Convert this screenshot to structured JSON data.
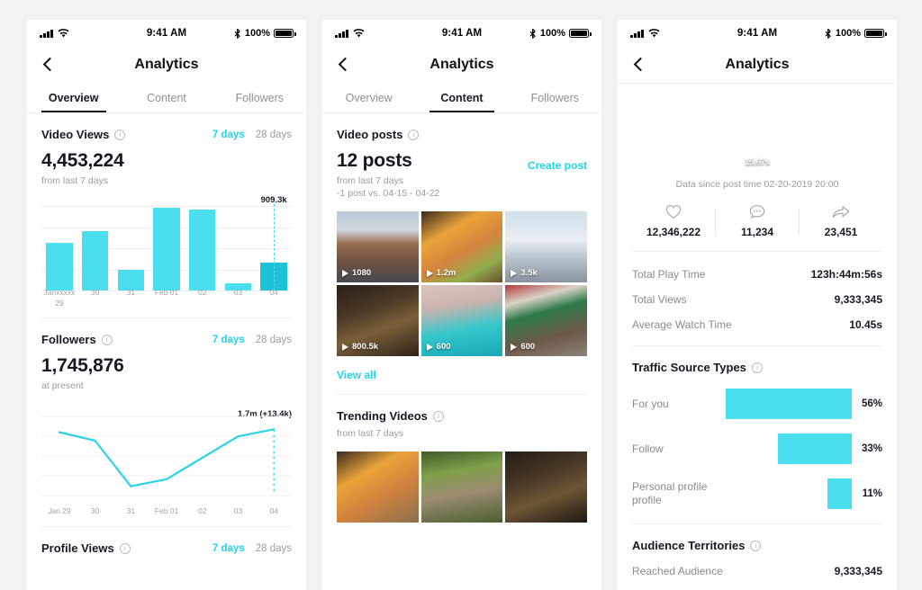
{
  "statusbar": {
    "time": "9:41 AM",
    "battery_pct": "100%",
    "signal_icon": "signal-bars-icon",
    "wifi_icon": "wifi-icon",
    "bluetooth_icon": "bluetooth-icon",
    "battery_icon": "battery-icon"
  },
  "nav": {
    "title": "Analytics",
    "back_icon": "back-chevron-icon"
  },
  "tabs": {
    "overview": "Overview",
    "content": "Content",
    "followers": "Followers"
  },
  "range": {
    "seven": "7 days",
    "twentyeight": "28 days"
  },
  "colors": {
    "accent": "#20d5ec",
    "bar": "#4adeee",
    "bar_highlight": "#1cc3d7",
    "text": "#161823",
    "muted": "#9b9b9b"
  },
  "panel1": {
    "video_views": {
      "title": "Video Views",
      "value": "4,453,224",
      "subnote": "from last 7 days"
    },
    "followers": {
      "title": "Followers",
      "value": "1,745,876",
      "subnote": "at present"
    },
    "profile_views": {
      "title": "Profile Views"
    }
  },
  "panel2": {
    "video_posts": {
      "title": "Video posts",
      "count": "12 posts",
      "create_post": "Create post",
      "subnote1": "from last 7 days",
      "subnote2": "-1 post vs. 04-15 - 04-22",
      "view_all": "View all",
      "posts": [
        {
          "views": "1080",
          "name": "city-street-thumbnail"
        },
        {
          "views": "1.2m",
          "name": "burger-thumbnail"
        },
        {
          "views": "3.5k",
          "name": "snow-picnic-thumbnail"
        },
        {
          "views": "800.5k",
          "name": "dark-corridor-thumbnail"
        },
        {
          "views": "600",
          "name": "venice-gondola-thumbnail"
        },
        {
          "views": "600",
          "name": "cafe-terrace-thumbnail"
        }
      ]
    },
    "trending": {
      "title": "Trending Videos",
      "subnote": "from last 7 days",
      "posts": [
        {
          "name": "burger-fries-thumbnail"
        },
        {
          "name": "deer-thumbnail"
        },
        {
          "name": "arcade-corridor-thumbnail"
        }
      ]
    }
  },
  "panel3": {
    "hero": {
      "duration": "15.67s",
      "since": "Data since post time 02-20-2019 20:00"
    },
    "stats": [
      {
        "icon": "heart-icon",
        "value": "12,346,222"
      },
      {
        "icon": "comment-icon",
        "value": "11,234"
      },
      {
        "icon": "share-icon",
        "value": "23,451"
      }
    ],
    "metrics": [
      {
        "label": "Total Play Time",
        "value": "123h:44m:56s"
      },
      {
        "label": "Total Views",
        "value": "9,333,345"
      },
      {
        "label": "Average Watch Time",
        "value": "10.45s"
      }
    ],
    "traffic": {
      "title": "Traffic Source Types",
      "rows": [
        {
          "label": "For you",
          "pct": "56%"
        },
        {
          "label": "Follow",
          "pct": "33%"
        },
        {
          "label": "Personal profile profile",
          "pct": "11%"
        }
      ]
    },
    "territories": {
      "title": "Audience Territories",
      "row_label": "Reached Audience",
      "row_value": "9,333,345"
    }
  },
  "chart_data": [
    {
      "type": "bar",
      "title": "Video Views",
      "categories": [
        "Janxxxxx 29",
        "30",
        "31",
        "Feb 01",
        "02",
        "03",
        "04"
      ],
      "values": [
        560,
        700,
        250,
        980,
        960,
        90,
        330
      ],
      "peak_label": "909.3k",
      "peak_index": 6,
      "highlight_index": 6,
      "ylim": [
        0,
        1000
      ],
      "xlabel": "",
      "ylabel": "",
      "grid": true,
      "legend": "none"
    },
    {
      "type": "line",
      "title": "Followers",
      "categories": [
        "Jan 29",
        "30",
        "31",
        "Feb 01",
        "02",
        "03",
        "04"
      ],
      "values": [
        1.69,
        1.66,
        1.5,
        1.525,
        1.6,
        1.675,
        1.7
      ],
      "annotation": "1.7m (+13.4k)",
      "ylim": [
        1.48,
        1.72
      ],
      "xlabel": "",
      "ylabel": "",
      "grid": true,
      "legend": "none"
    },
    {
      "type": "bar",
      "title": "Traffic Source Types",
      "orientation": "horizontal",
      "categories": [
        "For you",
        "Follow",
        "Personal profile profile"
      ],
      "values": [
        56,
        33,
        11
      ],
      "value_labels": [
        "56%",
        "33%",
        "11%"
      ],
      "xlabel": "",
      "ylabel": "",
      "ylim": [
        0,
        100
      ],
      "grid": false,
      "legend": "none"
    }
  ]
}
